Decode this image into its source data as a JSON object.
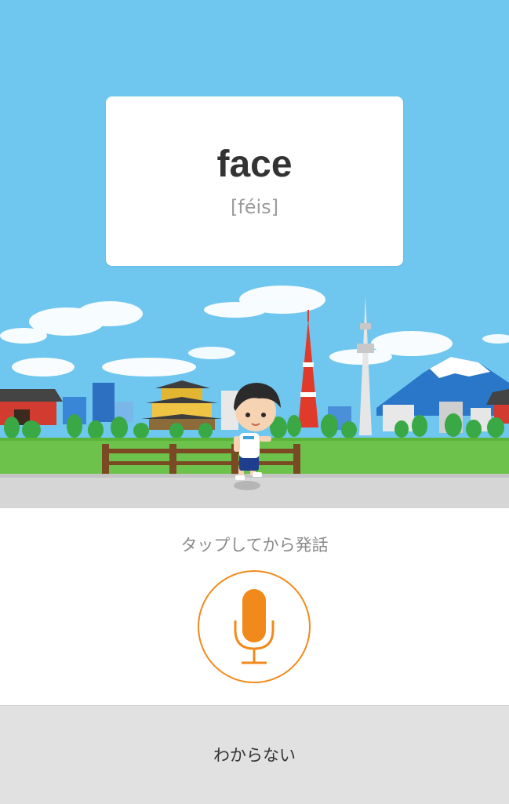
{
  "card": {
    "word": "face",
    "pronunciation": "[féis]"
  },
  "hint": "タップしてから発話",
  "mic": {
    "icon": "microphone-icon",
    "color": "#f28a1b"
  },
  "footer": {
    "label": "わからない"
  },
  "colors": {
    "sky": "#6fc6ee",
    "grass": "#6cc24a",
    "road": "#d6d6d6"
  }
}
